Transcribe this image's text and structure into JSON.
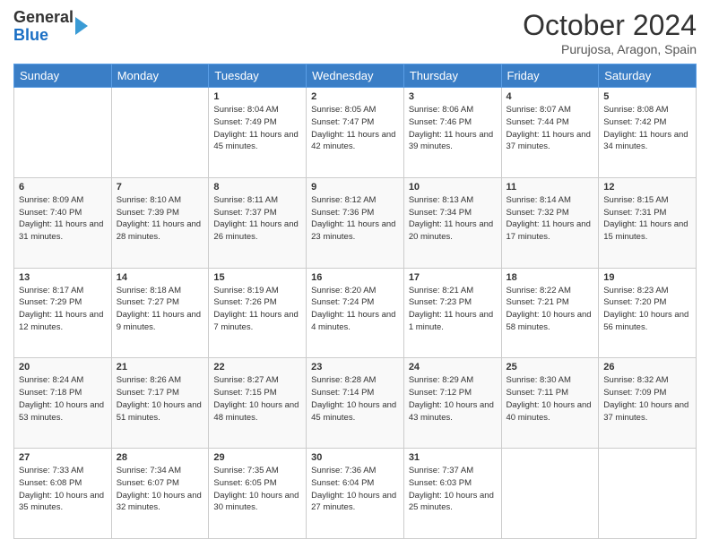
{
  "logo": {
    "line1": "General",
    "line2": "Blue"
  },
  "title": "October 2024",
  "subtitle": "Purujosa, Aragon, Spain",
  "days_of_week": [
    "Sunday",
    "Monday",
    "Tuesday",
    "Wednesday",
    "Thursday",
    "Friday",
    "Saturday"
  ],
  "weeks": [
    [
      {
        "day": "",
        "info": ""
      },
      {
        "day": "",
        "info": ""
      },
      {
        "day": "1",
        "info": "Sunrise: 8:04 AM\nSunset: 7:49 PM\nDaylight: 11 hours and 45 minutes."
      },
      {
        "day": "2",
        "info": "Sunrise: 8:05 AM\nSunset: 7:47 PM\nDaylight: 11 hours and 42 minutes."
      },
      {
        "day": "3",
        "info": "Sunrise: 8:06 AM\nSunset: 7:46 PM\nDaylight: 11 hours and 39 minutes."
      },
      {
        "day": "4",
        "info": "Sunrise: 8:07 AM\nSunset: 7:44 PM\nDaylight: 11 hours and 37 minutes."
      },
      {
        "day": "5",
        "info": "Sunrise: 8:08 AM\nSunset: 7:42 PM\nDaylight: 11 hours and 34 minutes."
      }
    ],
    [
      {
        "day": "6",
        "info": "Sunrise: 8:09 AM\nSunset: 7:40 PM\nDaylight: 11 hours and 31 minutes."
      },
      {
        "day": "7",
        "info": "Sunrise: 8:10 AM\nSunset: 7:39 PM\nDaylight: 11 hours and 28 minutes."
      },
      {
        "day": "8",
        "info": "Sunrise: 8:11 AM\nSunset: 7:37 PM\nDaylight: 11 hours and 26 minutes."
      },
      {
        "day": "9",
        "info": "Sunrise: 8:12 AM\nSunset: 7:36 PM\nDaylight: 11 hours and 23 minutes."
      },
      {
        "day": "10",
        "info": "Sunrise: 8:13 AM\nSunset: 7:34 PM\nDaylight: 11 hours and 20 minutes."
      },
      {
        "day": "11",
        "info": "Sunrise: 8:14 AM\nSunset: 7:32 PM\nDaylight: 11 hours and 17 minutes."
      },
      {
        "day": "12",
        "info": "Sunrise: 8:15 AM\nSunset: 7:31 PM\nDaylight: 11 hours and 15 minutes."
      }
    ],
    [
      {
        "day": "13",
        "info": "Sunrise: 8:17 AM\nSunset: 7:29 PM\nDaylight: 11 hours and 12 minutes."
      },
      {
        "day": "14",
        "info": "Sunrise: 8:18 AM\nSunset: 7:27 PM\nDaylight: 11 hours and 9 minutes."
      },
      {
        "day": "15",
        "info": "Sunrise: 8:19 AM\nSunset: 7:26 PM\nDaylight: 11 hours and 7 minutes."
      },
      {
        "day": "16",
        "info": "Sunrise: 8:20 AM\nSunset: 7:24 PM\nDaylight: 11 hours and 4 minutes."
      },
      {
        "day": "17",
        "info": "Sunrise: 8:21 AM\nSunset: 7:23 PM\nDaylight: 11 hours and 1 minute."
      },
      {
        "day": "18",
        "info": "Sunrise: 8:22 AM\nSunset: 7:21 PM\nDaylight: 10 hours and 58 minutes."
      },
      {
        "day": "19",
        "info": "Sunrise: 8:23 AM\nSunset: 7:20 PM\nDaylight: 10 hours and 56 minutes."
      }
    ],
    [
      {
        "day": "20",
        "info": "Sunrise: 8:24 AM\nSunset: 7:18 PM\nDaylight: 10 hours and 53 minutes."
      },
      {
        "day": "21",
        "info": "Sunrise: 8:26 AM\nSunset: 7:17 PM\nDaylight: 10 hours and 51 minutes."
      },
      {
        "day": "22",
        "info": "Sunrise: 8:27 AM\nSunset: 7:15 PM\nDaylight: 10 hours and 48 minutes."
      },
      {
        "day": "23",
        "info": "Sunrise: 8:28 AM\nSunset: 7:14 PM\nDaylight: 10 hours and 45 minutes."
      },
      {
        "day": "24",
        "info": "Sunrise: 8:29 AM\nSunset: 7:12 PM\nDaylight: 10 hours and 43 minutes."
      },
      {
        "day": "25",
        "info": "Sunrise: 8:30 AM\nSunset: 7:11 PM\nDaylight: 10 hours and 40 minutes."
      },
      {
        "day": "26",
        "info": "Sunrise: 8:32 AM\nSunset: 7:09 PM\nDaylight: 10 hours and 37 minutes."
      }
    ],
    [
      {
        "day": "27",
        "info": "Sunrise: 7:33 AM\nSunset: 6:08 PM\nDaylight: 10 hours and 35 minutes."
      },
      {
        "day": "28",
        "info": "Sunrise: 7:34 AM\nSunset: 6:07 PM\nDaylight: 10 hours and 32 minutes."
      },
      {
        "day": "29",
        "info": "Sunrise: 7:35 AM\nSunset: 6:05 PM\nDaylight: 10 hours and 30 minutes."
      },
      {
        "day": "30",
        "info": "Sunrise: 7:36 AM\nSunset: 6:04 PM\nDaylight: 10 hours and 27 minutes."
      },
      {
        "day": "31",
        "info": "Sunrise: 7:37 AM\nSunset: 6:03 PM\nDaylight: 10 hours and 25 minutes."
      },
      {
        "day": "",
        "info": ""
      },
      {
        "day": "",
        "info": ""
      }
    ]
  ]
}
